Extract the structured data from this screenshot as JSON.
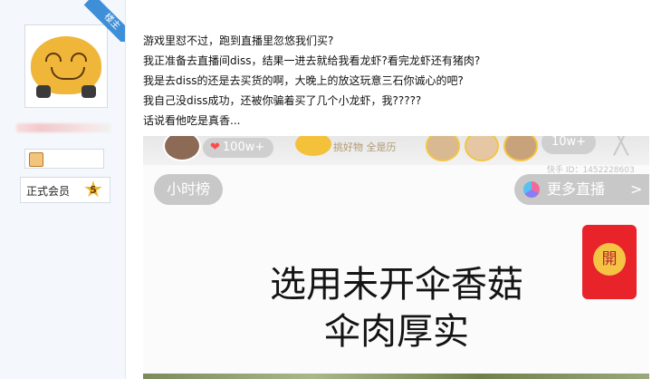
{
  "user": {
    "badge": "楼主",
    "member_label": "正式会员",
    "level": "5"
  },
  "post": {
    "lines": [
      "游戏里怼不过，跑到直播里忽悠我们买?",
      "我正准备去直播间diss，结果一进去就给我看龙虾?看完龙虾还有猪肉?",
      "我是去diss的还是去买货的啊，大晚上的放这玩意三石你诚心的吧?",
      "我自己没diss成功，还被你骗着买了几个小龙虾，我?????",
      "话说看他吃是真香..."
    ]
  },
  "screenshot": {
    "likes": "100w+",
    "shop_text": "挑好物 全是历",
    "fans": "10w+",
    "room_id": "快手 ID：1452228603",
    "hour_rank": "小时榜",
    "more_live": "更多直播",
    "more_live_chevron": ">",
    "red_packet": "開",
    "caption_line1": "选用未开伞香菇",
    "caption_line2": "伞肉厚实",
    "heart_icon": "❤",
    "close_icon": "╳"
  }
}
